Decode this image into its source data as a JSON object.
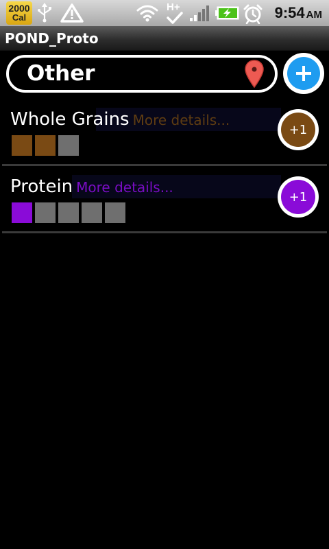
{
  "status_bar": {
    "badge_number": "2000",
    "badge_unit": "Cal",
    "network_label": "H+",
    "time": "9:54",
    "ampm": "AM",
    "icons": [
      "usb-icon",
      "warning-icon",
      "wifi-icon",
      "network-h-plus-icon",
      "signal-icon",
      "battery-charging-icon",
      "alarm-clock-icon"
    ]
  },
  "app": {
    "title": "POND_Proto"
  },
  "location": {
    "name": "Other",
    "icon": "map-pin-icon",
    "pin_color": "#ee5a52"
  },
  "add_button": {
    "icon": "plus-icon",
    "color": "#1e9cf0"
  },
  "food_groups": [
    {
      "name": "Whole Grains",
      "details_label": "More details...",
      "color": "#7a4a14",
      "details_color": "#5e3c12",
      "servings_filled": 2,
      "servings_total": 3,
      "increment_label": "+1"
    },
    {
      "name": "Protein",
      "details_label": "More details...",
      "color": "#8a0bd8",
      "details_color": "#7a0dc4",
      "servings_filled": 1,
      "servings_total": 5,
      "increment_label": "+1"
    }
  ]
}
